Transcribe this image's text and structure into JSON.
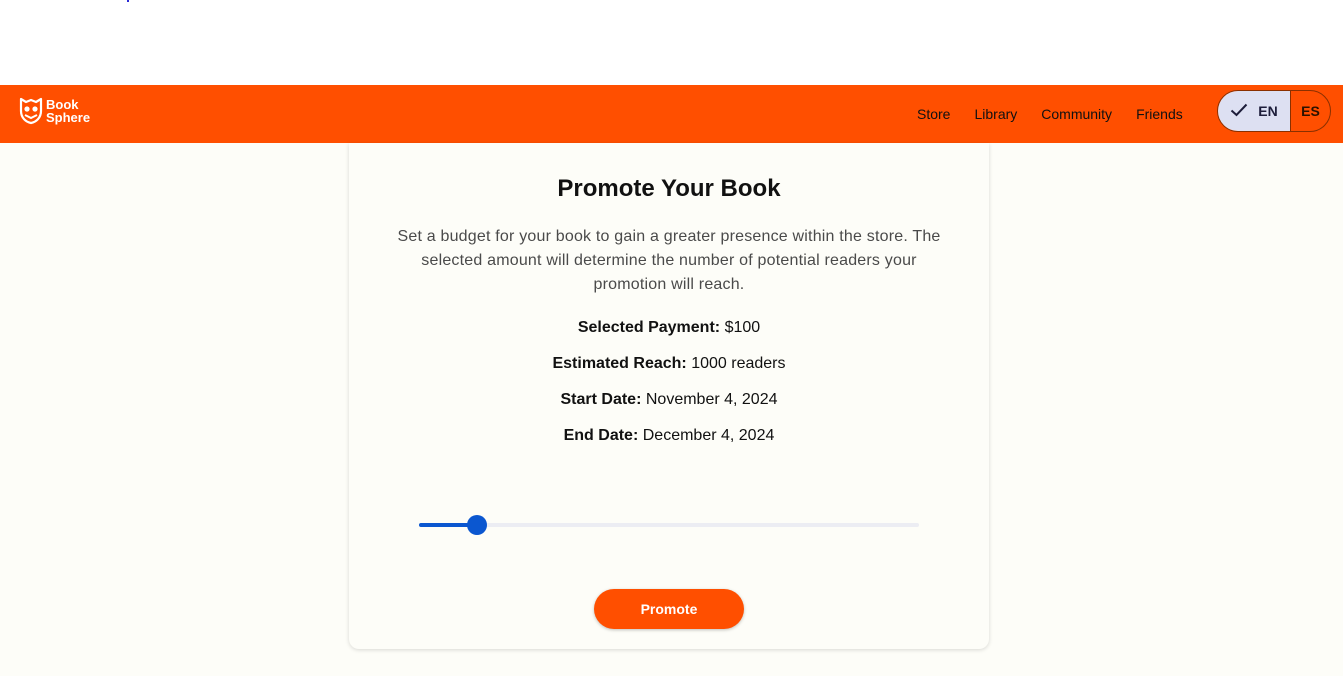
{
  "brand": {
    "line1": "Book",
    "line2": "Sphere",
    "logo_icon": "owl-book-logo"
  },
  "nav": {
    "links": [
      "Store",
      "Library",
      "Community",
      "Friends"
    ]
  },
  "language": {
    "options": [
      "EN",
      "ES"
    ],
    "selected": "EN",
    "check_icon": "check-icon"
  },
  "promo": {
    "title": "Promote Your Book",
    "description": "Set a budget for your book to gain a greater presence within the store. The selected amount will determine the number of potential readers your promotion will reach.",
    "payment_label": "Selected Payment:",
    "payment_value": "$100",
    "reach_label": "Estimated Reach:",
    "reach_value": "1000 readers",
    "start_label": "Start Date:",
    "start_value": "November 4, 2024",
    "end_label": "End Date:",
    "end_value": "December 4, 2024",
    "slider_fraction": 0.116,
    "button_label": "Promote"
  },
  "colors": {
    "brand_orange": "#ff4f00",
    "slider_blue": "#0b57d0",
    "lang_selected_bg": "#dde0f2"
  }
}
